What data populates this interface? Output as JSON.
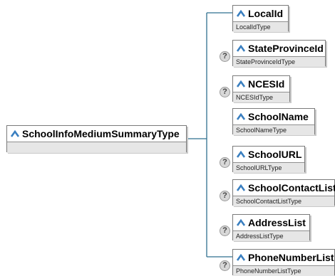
{
  "root": {
    "name": "SchoolInfoMediumSummaryType",
    "type": ""
  },
  "elements": [
    {
      "name": "LocalId",
      "type": "LocalIdType",
      "optional": false
    },
    {
      "name": "StateProvinceId",
      "type": "StateProvinceIdType",
      "optional": true
    },
    {
      "name": "NCESId",
      "type": "NCESIdType",
      "optional": true
    },
    {
      "name": "SchoolName",
      "type": "SchoolNameType",
      "optional": false
    },
    {
      "name": "SchoolURL",
      "type": "SchoolURLType",
      "optional": true
    },
    {
      "name": "SchoolContactList",
      "type": "SchoolContactListType",
      "optional": true
    },
    {
      "name": "AddressList",
      "type": "AddressListType",
      "optional": true
    },
    {
      "name": "PhoneNumberList",
      "type": "PhoneNumberListType",
      "optional": true
    }
  ],
  "optional_marker": "?",
  "colors": {
    "connector": "#2f6f8f",
    "icon": "#3a7fc0",
    "subtype_bg": "#e6e6e6",
    "border": "#7a7a7a"
  },
  "icons": {
    "element": "element-icon",
    "optional": "question-mark-icon"
  }
}
